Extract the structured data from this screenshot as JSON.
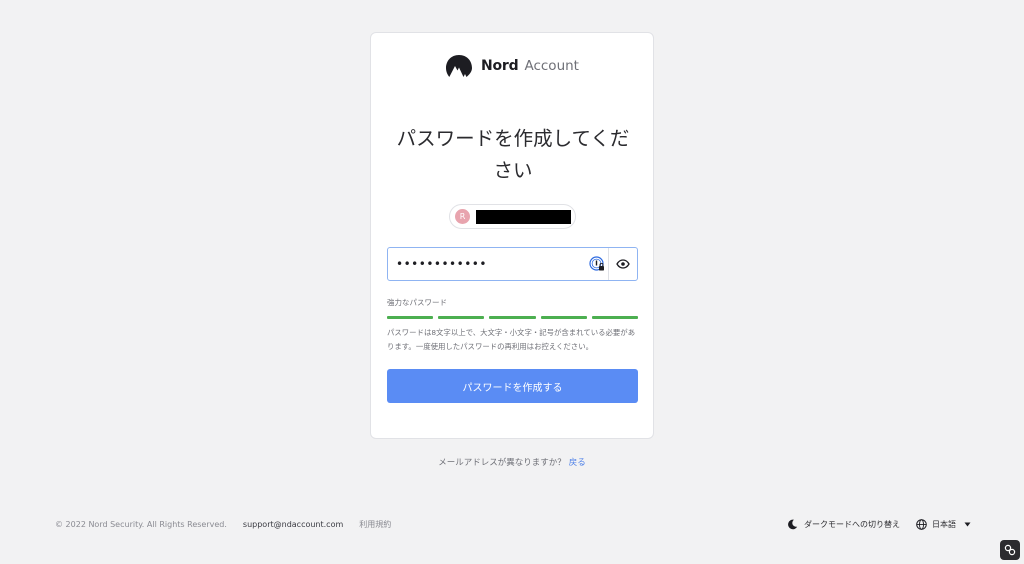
{
  "header": {
    "brand": "Nord",
    "brand_sub": "Account"
  },
  "page": {
    "title_line1": "パスワードを作成してくだ",
    "title_line2": "さい"
  },
  "account": {
    "avatar_initial": "R"
  },
  "password": {
    "value": "••••••••••••"
  },
  "strength": {
    "label": "強力なパスワード",
    "segments": 5,
    "color": "#4caf50"
  },
  "hint": {
    "text": "パスワードは8文字以上で、大文字・小文字・記号が含まれている必要があります。一度使用したパスワードの再利用はお控えください。"
  },
  "submit": {
    "label": "パスワードを作成する"
  },
  "email_change": {
    "question": "メールアドレスが異なりますか？",
    "link": "戻る"
  },
  "footer": {
    "copyright": "© 2022 Nord Security. All Rights Reserved.",
    "support_email": "support@ndaccount.com",
    "terms": "利用規約",
    "dark_mode": "ダークモードへの切り替え",
    "language": "日本語"
  },
  "colors": {
    "accent": "#5a8cf4",
    "link": "#4a7ee8",
    "background": "#f2f2f3",
    "strength": "#4caf50"
  }
}
